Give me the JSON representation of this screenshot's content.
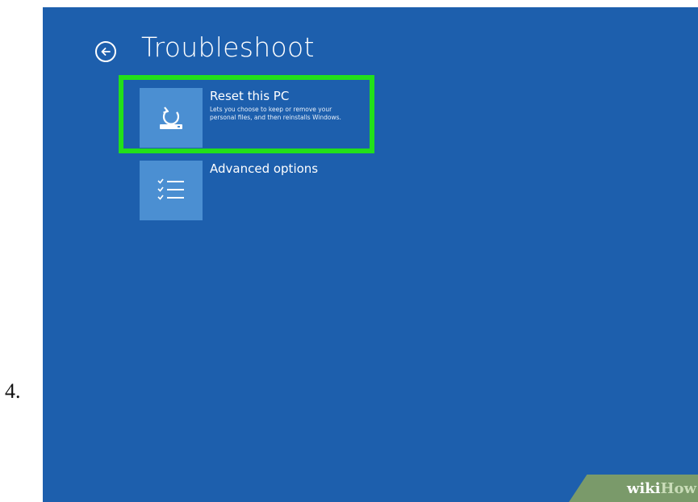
{
  "step_number": "4.",
  "screen": {
    "title": "Troubleshoot",
    "back_icon": "back-arrow-circle-icon",
    "options": [
      {
        "title": "Reset this PC",
        "description": "Lets you choose to keep or remove your personal files, and then reinstalls Windows.",
        "icon": "reset-drive-icon",
        "highlighted": true
      },
      {
        "title": "Advanced options",
        "description": "",
        "icon": "checklist-icon",
        "highlighted": false
      }
    ]
  },
  "watermark": {
    "part1": "wiki",
    "part2": "How"
  },
  "colors": {
    "background": "#1d5fad",
    "tile": "#4b8fd2",
    "highlight": "#22e01a",
    "text": "#ffffff"
  }
}
